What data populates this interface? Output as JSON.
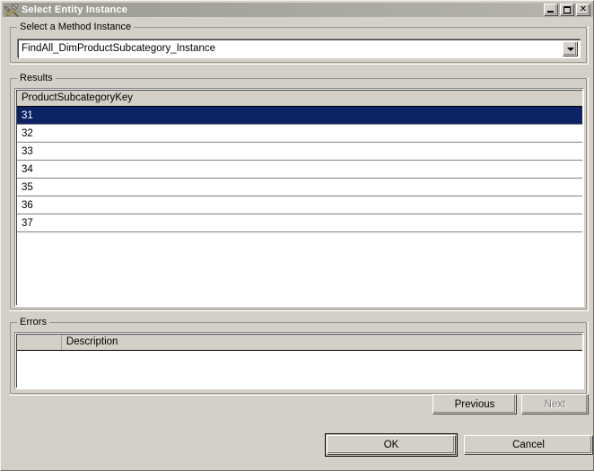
{
  "window": {
    "title": "Select Entity Instance",
    "icon": "tools-icon",
    "controls": {
      "minimize": "minimize-icon",
      "maximize": "maximize-icon",
      "close": "✕"
    }
  },
  "method_group": {
    "legend": "Select a Method Instance",
    "combo": {
      "value": "FindAll_DimProductSubcategory_Instance",
      "arrow": "chevron-down-icon"
    }
  },
  "results_group": {
    "legend": "Results",
    "grid": {
      "columns": [
        "ProductSubcategoryKey"
      ],
      "rows": [
        {
          "ProductSubcategoryKey": "31",
          "selected": true
        },
        {
          "ProductSubcategoryKey": "32",
          "selected": false
        },
        {
          "ProductSubcategoryKey": "33",
          "selected": false
        },
        {
          "ProductSubcategoryKey": "34",
          "selected": false
        },
        {
          "ProductSubcategoryKey": "35",
          "selected": false
        },
        {
          "ProductSubcategoryKey": "36",
          "selected": false
        },
        {
          "ProductSubcategoryKey": "37",
          "selected": false
        }
      ]
    }
  },
  "errors_group": {
    "legend": "Errors",
    "grid": {
      "columns": [
        "",
        "Description"
      ],
      "rows": []
    }
  },
  "pager": {
    "previous_label": "Previous",
    "previous_enabled": true,
    "next_label": "Next",
    "next_enabled": false
  },
  "dialog_buttons": {
    "ok_label": "OK",
    "cancel_label": "Cancel"
  },
  "colors": {
    "face": "#d4d0c8",
    "titlebar_start": "#9b9b92",
    "titlebar_end": "#b6b4ab",
    "selection": "#0d2365",
    "selection_text": "#ffffff",
    "disabled_text": "#808080"
  }
}
